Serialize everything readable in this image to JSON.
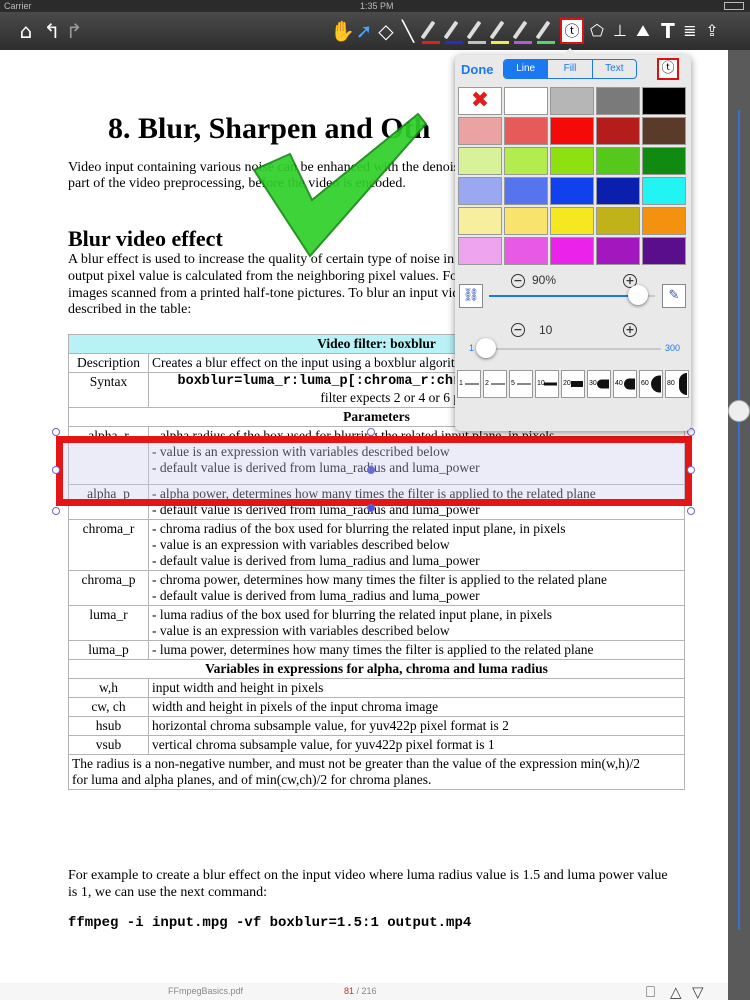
{
  "status": {
    "carrier": "Carrier",
    "time": "1:35 PM"
  },
  "toolbar": {
    "icons": [
      "home-icon",
      "undo-icon",
      "redo-icon",
      "hand-icon",
      "pointer-icon",
      "eraser-icon",
      "line-icon",
      "pen-red-icon",
      "pen-blue-icon",
      "pencil-icon",
      "highlighter-yellow-icon",
      "highlighter-purple-icon",
      "highlighter-green-icon",
      "text-stamp-icon",
      "shapes-icon",
      "signature-icon",
      "image-icon",
      "text-icon",
      "text-box-icon",
      "share-icon"
    ],
    "pen_colors": [
      "#e02020",
      "#2030d0",
      "#c0c0c0",
      "#f5e94a",
      "#b35ad8",
      "#5ad36a"
    ]
  },
  "document": {
    "chapter_title": "8. Blur, Sharpen and Oth",
    "intro": [
      "Video input containing various noise can be enhanced with the denoise filters and it can be used as a",
      "part of the video preprocessing, before the video is encoded."
    ],
    "section_title": "Blur video effect",
    "section_lines": [
      "A blur effect is used to increase the quality of certain type of noise in images (video frames), where each",
      "output pixel value is calculated from the neighboring pixel values. For instance, a blur effect can improve",
      "images scanned from a printed half-tone pictures. To blur an input video we can use a boxblur filter",
      "described in the table:"
    ],
    "table": {
      "title": "Video filter: boxblur",
      "description_key": "Description",
      "description_val": "Creates a blur effect on the input using a boxblur algorithm on the input's pixels",
      "syntax_key": "Syntax",
      "syntax_code": "boxblur=luma_r:luma_p[:chroma_r:chroma_p[:alpha_r:alpha_p]]",
      "syntax_note": "filter expects 2 or 4 or 6 parameters",
      "params_header": "Parameters",
      "rows": [
        {
          "key": "alpha_r",
          "lines": [
            "- alpha radius of the box used for blurring the related input plane, in pixels",
            "- value is an expression with variables described below",
            "- default value is derived from luma_radius and luma_power"
          ]
        },
        {
          "key": "alpha_p",
          "lines": [
            "- alpha power, determines how many times the filter is applied to the related plane",
            "- default value is derived from luma_radius and luma_power"
          ]
        },
        {
          "key": "chroma_r",
          "lines": [
            "- chroma radius of the box used for blurring the related input plane, in pixels",
            "- value is an expression with variables described below",
            "- default value is derived from luma_radius and luma_power"
          ]
        },
        {
          "key": "chroma_p",
          "lines": [
            "- chroma power, determines how many times the filter is applied to the related plane",
            "- default value is derived from luma_radius and luma_power"
          ]
        },
        {
          "key": "luma_r",
          "lines": [
            "- luma radius of the box used for blurring the related input plane, in pixels",
            "- value is an expression with variables described below"
          ]
        },
        {
          "key": "luma_p",
          "lines": [
            "- luma power, determines how many times the filter is applied to the related plane"
          ]
        }
      ],
      "vars_header": "Variables in expressions for alpha, chroma and luma radius",
      "vars": [
        {
          "key": "w,h",
          "val": "input width and height in pixels"
        },
        {
          "key": "cw, ch",
          "val": "width and height in pixels of the input chroma image"
        },
        {
          "key": "hsub",
          "val": "horizontal chroma subsample value, for yuv422p pixel format is 2"
        },
        {
          "key": "vsub",
          "val": "vertical chroma subsample value, for yuv422p pixel format is 1"
        }
      ],
      "footer": [
        "The radius is a non-negative number, and must not be greater than the value of the expression min(w,h)/2",
        "for luma and alpha planes, and of min(cw,ch)/2 for chroma planes."
      ]
    },
    "example": [
      "For example to create a blur effect on the input video where luma radius value is 1.5 and luma power value",
      "is 1, we can use  the next command:"
    ],
    "command": "ffmpeg -i input.mpg -vf boxblur=1.5:1 output.mp4"
  },
  "popover": {
    "done": "Done",
    "tabs": [
      "Line",
      "Fill",
      "Text"
    ],
    "active_tab": "Line",
    "palette": [
      "none",
      "#ffffff",
      "#b6b6b6",
      "#7a7a7a",
      "#000000",
      "#eaa2a2",
      "#e65a5a",
      "#f50a0a",
      "#b51c1c",
      "#5a3b2a",
      "#d8f29a",
      "#b2ec4d",
      "#8ee011",
      "#56c81c",
      "#118a12",
      "#9aa8f2",
      "#5574ee",
      "#1141ee",
      "#0a1fae",
      "#22f4f4",
      "#f8ef9e",
      "#f8e36c",
      "#f5e820",
      "#c2b21a",
      "#f4920f",
      "#eea4ee",
      "#e65ae6",
      "#ea22ea",
      "#a218be",
      "#5a0e8c"
    ],
    "opacity_label": "90%",
    "opacity": 0.9,
    "width_label": "10",
    "width_min": "1",
    "width_max": "300",
    "width_value": 10,
    "width_presets": [
      "1",
      "2",
      "5",
      "10",
      "20",
      "30",
      "40",
      "60",
      "80"
    ]
  },
  "footer": {
    "file": "FFmpegBasics.pdf",
    "page": "81",
    "total": "/ 216"
  }
}
